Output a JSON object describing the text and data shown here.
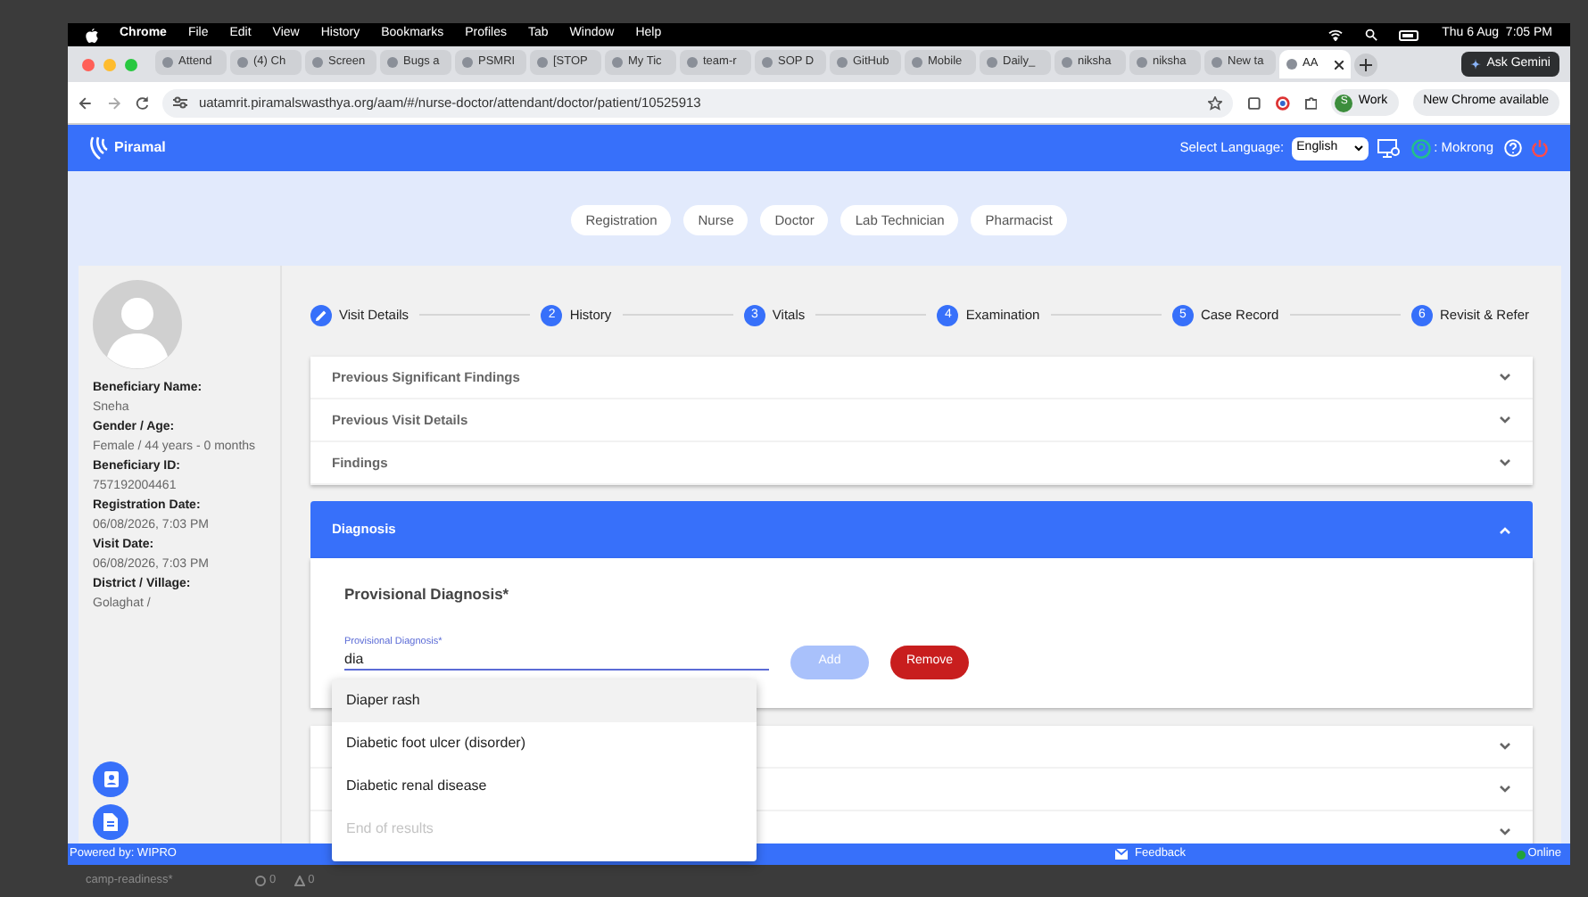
{
  "menu_bar": {
    "app": "Chrome",
    "items": [
      "File",
      "Edit",
      "View",
      "History",
      "Bookmarks",
      "Profiles",
      "Tab",
      "Window",
      "Help"
    ],
    "clock": "Thu 6 Aug  7:05 PM"
  },
  "browser_tabs": [
    {
      "title": "Attend",
      "selected": false
    },
    {
      "title": "(4) Ch",
      "selected": false
    },
    {
      "title": "Screen",
      "selected": false
    },
    {
      "title": "Bugs a",
      "selected": false
    },
    {
      "title": "PSMRI",
      "selected": false
    },
    {
      "title": "[STOP",
      "selected": false
    },
    {
      "title": "My Tic",
      "selected": false
    },
    {
      "title": "team-r",
      "selected": false
    },
    {
      "title": "SOP D",
      "selected": false
    },
    {
      "title": "GitHub",
      "selected": false
    },
    {
      "title": "Mobile",
      "selected": false
    },
    {
      "title": "Daily_",
      "selected": false
    },
    {
      "title": "niksha",
      "selected": false
    },
    {
      "title": "niksha",
      "selected": false
    },
    {
      "title": "New ta",
      "selected": false
    },
    {
      "title": "AA",
      "selected": true
    }
  ],
  "gemini_button": "Ask Gemini",
  "address_bar": {
    "url": "uatamrit.piramalswasthya.org/aam/#/nurse-doctor/attendant/doctor/patient/10525913"
  },
  "profile_chip": {
    "initial": "S",
    "label": "Work"
  },
  "update_button": "New Chrome available",
  "app_header": {
    "logo": "Piramal",
    "language_label": "Select Language:",
    "language": "English",
    "user": ": Mokrong"
  },
  "roles": [
    "Registration",
    "Nurse",
    "Doctor",
    "Lab Technician",
    "Pharmacist"
  ],
  "beneficiary": [
    {
      "label": "Beneficiary Name:",
      "value": "Sneha"
    },
    {
      "label": "Gender / Age:",
      "value": "Female / 44 years - 0 months"
    },
    {
      "label": "Beneficiary ID:",
      "value": "757192004461"
    },
    {
      "label": "Registration Date:",
      "value": "06/08/2026, 7:03 PM"
    },
    {
      "label": "Visit Date:",
      "value": "06/08/2026, 7:03 PM"
    },
    {
      "label": "District / Village:",
      "value": "Golaghat /"
    }
  ],
  "steps": [
    {
      "kind": "edit",
      "label": "Visit Details"
    },
    {
      "kind": "number",
      "number": "2",
      "label": "History"
    },
    {
      "kind": "number",
      "number": "3",
      "label": "Vitals"
    },
    {
      "kind": "number",
      "number": "4",
      "label": "Examination"
    },
    {
      "kind": "number",
      "number": "5",
      "label": "Case Record"
    },
    {
      "kind": "number",
      "number": "6",
      "label": "Revisit & Refer"
    }
  ],
  "panels": [
    {
      "title": "Previous Significant Findings",
      "expanded": false
    },
    {
      "title": "Previous Visit Details",
      "expanded": false
    },
    {
      "title": "Findings",
      "expanded": false
    }
  ],
  "diagnosis": {
    "title": "Diagnosis",
    "expanded": true,
    "heading": "Provisional Diagnosis*",
    "field": {
      "label": "Provisional Diagnosis*",
      "value": "dia"
    },
    "buttons": [
      {
        "label": "Add",
        "disabled": true
      },
      {
        "label": "Remove",
        "disabled": false
      }
    ]
  },
  "lower_panels": [
    {
      "expanded": false
    },
    {
      "expanded": false
    },
    {
      "expanded": false
    }
  ],
  "autocomplete": {
    "options": [
      {
        "label": "Diaper rash",
        "selected": true
      },
      {
        "label": "Diabetic foot ulcer (disorder)",
        "selected": false
      },
      {
        "label": "Diabetic renal disease",
        "selected": false
      }
    ],
    "end_note": "End of results"
  },
  "footer": {
    "powered_by": "Powered by: WIPRO",
    "feedback": "Feedback",
    "status": "Online"
  },
  "desktop_status": {
    "branch": "camp-readiness*",
    "errors": "0",
    "warnings": "0"
  }
}
